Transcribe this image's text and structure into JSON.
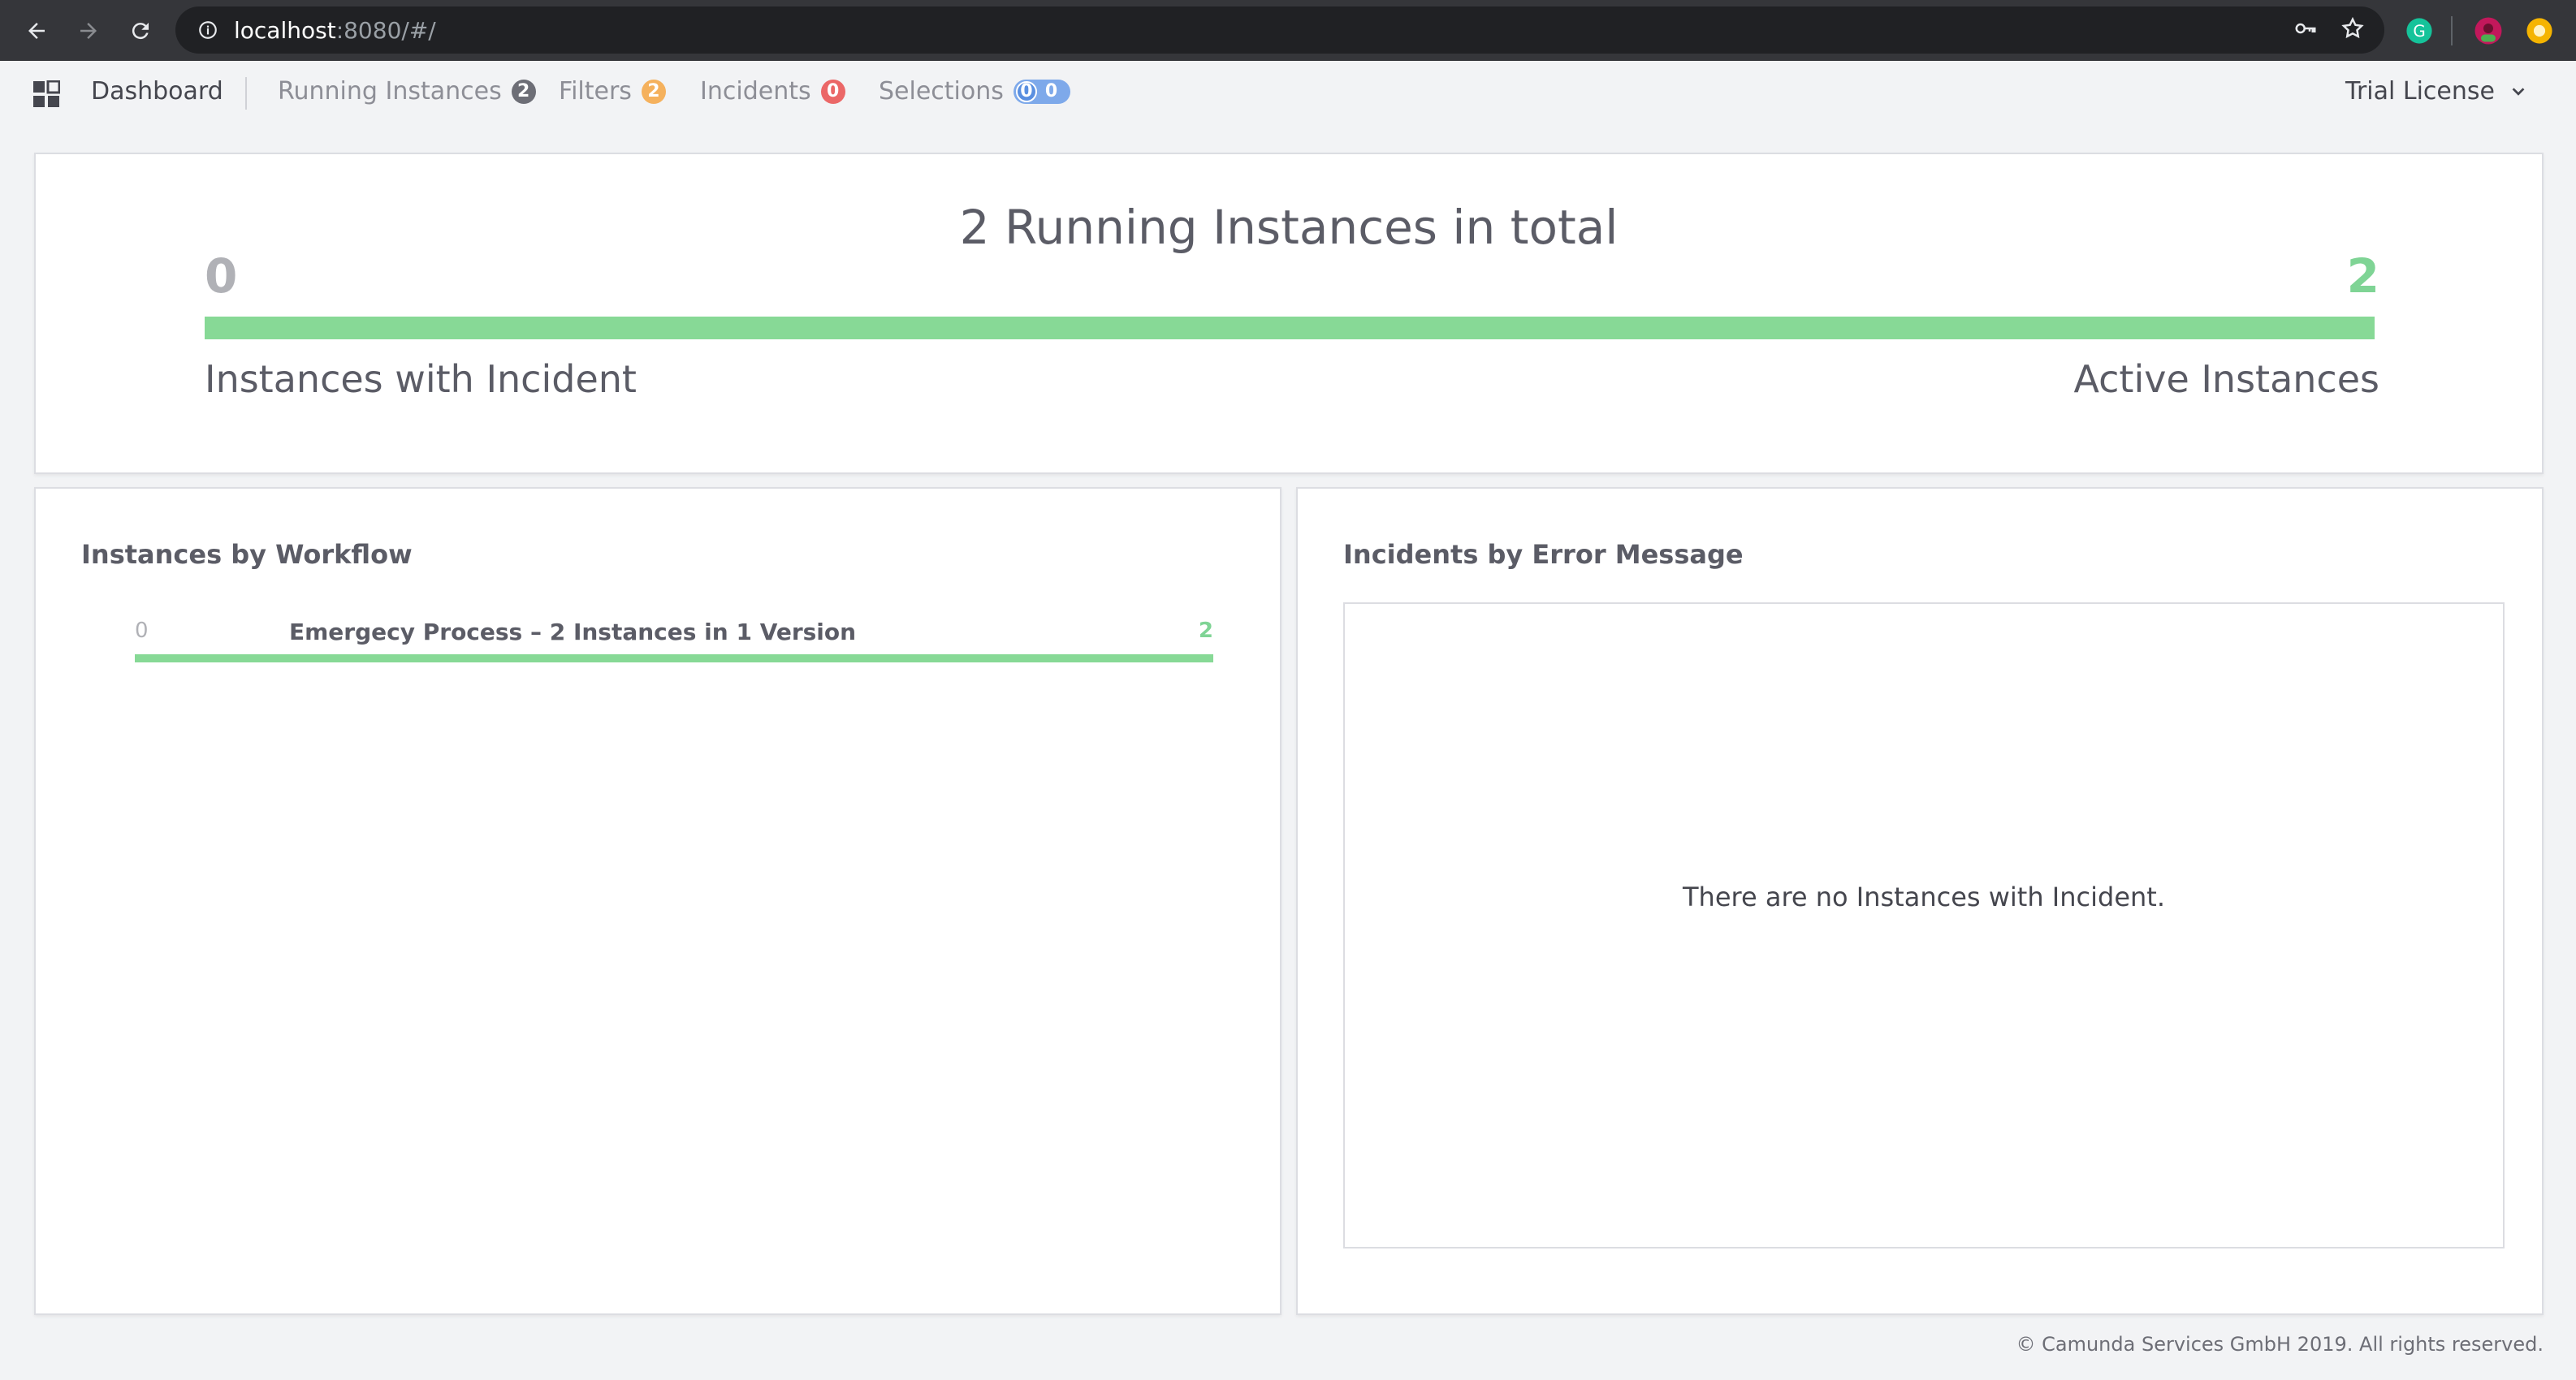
{
  "browser": {
    "url_host": "localhost",
    "url_rest": ":8080/#/"
  },
  "header": {
    "dashboard_label": "Dashboard",
    "nav": [
      {
        "label": "Running Instances",
        "count": "2"
      },
      {
        "label": "Filters",
        "count": "2"
      },
      {
        "label": "Incidents",
        "count": "0"
      },
      {
        "label": "Selections",
        "count_inner": "0",
        "count_outer": "0"
      }
    ],
    "license_label": "Trial License"
  },
  "metric_panel": {
    "title": "2 Running Instances in total",
    "incident_count": "0",
    "active_count": "2",
    "active_fraction": 1.0,
    "incident_label": "Instances with Incident",
    "active_label": "Active Instances"
  },
  "workflow_panel": {
    "title": "Instances by Workflow",
    "rows": [
      {
        "incidents": "0",
        "name": "Emergecy Process – 2 Instances in 1 Version",
        "total": "2",
        "active_fraction": 1.0
      }
    ]
  },
  "incident_panel": {
    "title": "Incidents by Error Message",
    "empty_message": "There are no Instances with Incident."
  },
  "footer": {
    "copyright": "© Camunda Services GmbH 2019. All rights reserved."
  },
  "colors": {
    "active": "#87d996",
    "incident_badge": "#eb6767",
    "filter_badge": "#f5b15d",
    "selection_badge": "#7ea9ea"
  }
}
